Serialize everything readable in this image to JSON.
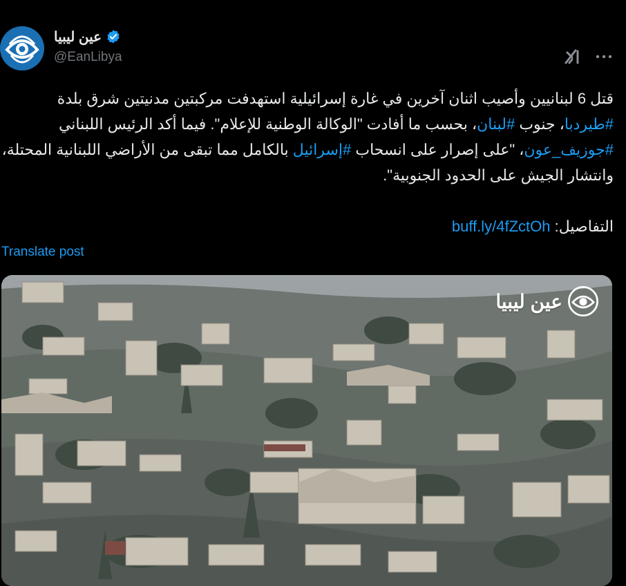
{
  "author": {
    "display_name": "عين ليبيا",
    "handle": "@EanLibya",
    "verified": true,
    "avatar_icon": "eye-logo-icon"
  },
  "header_actions": {
    "grok_icon": "grok-icon",
    "more_icon": "more-options-icon"
  },
  "post": {
    "line1_a": "قتل 6 لبنانيين وأصيب اثنان آخرين في غارة إسرائيلية استهدفت مركبتين مدنيتين شرق بلدة ",
    "hashtag1": "#طيردبا",
    "line1_b": "، جنوب ",
    "hashtag2": "#لبنان",
    "line1_c": "، بحسب ما أفادت \"الوكالة الوطنية للإعلام\". فيما أكد الرئيس اللبناني ",
    "hashtag3": "#جوزيف_عون",
    "line1_d": "، \"على إصرار على انسحاب ",
    "hashtag4": "#إسرائيل",
    "line1_e": " بالكامل مما تبقى من الأراضي اللبنانية المحتلة، وانتشار الجيش على الحدود الجنوبية\".",
    "details_label": "التفاصيل: ",
    "details_link": "buff.ly/4fZctOh"
  },
  "translate_label": "Translate post",
  "media": {
    "watermark_text": "عين ليبيا",
    "description_icon": "photo"
  },
  "colors": {
    "background": "#000000",
    "text": "#e7e9ea",
    "secondary": "#71767b",
    "link": "#1d9bf0"
  }
}
